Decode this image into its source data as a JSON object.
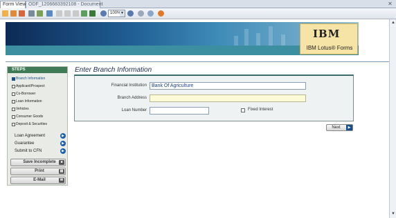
{
  "tabs": [
    {
      "label": "Form View"
    },
    {
      "label": "ODF_1206683392108 - Document"
    }
  ],
  "toolbar": {
    "zoom_value": "100%"
  },
  "banner": {
    "brand_logo": "IBM",
    "product_name": "IBM Lotus® Forms"
  },
  "sidebar": {
    "steps_title": "STEPS",
    "steps": [
      {
        "label": "Branch Information"
      },
      {
        "label": "Applicant/Prospect"
      },
      {
        "label": "Co-Borrower"
      },
      {
        "label": "Loan Information"
      },
      {
        "label": "Vehicles"
      },
      {
        "label": "Consumer Goods"
      },
      {
        "label": "Deposit & Securities"
      }
    ],
    "sections": [
      {
        "label": "Loan Agreement"
      },
      {
        "label": "Guarantee"
      },
      {
        "label": "Submit to CFN"
      }
    ],
    "actions": [
      {
        "label": "Save Incomplete",
        "icon": "save-icon"
      },
      {
        "label": "Print",
        "icon": "printer-icon"
      },
      {
        "label": "E-Mail",
        "icon": "mail-icon"
      }
    ]
  },
  "form": {
    "title": "Enter Branch Information",
    "fields": {
      "financial_institution_label": "Financial Institution",
      "financial_institution_value": "Bank Of Agriculture",
      "branch_address_label": "Branch Address",
      "branch_address_value": "",
      "loan_number_label": "Loan Number",
      "loan_number_value": "",
      "fixed_interest_label": "Fixed Interest"
    },
    "next_label": "Next"
  }
}
